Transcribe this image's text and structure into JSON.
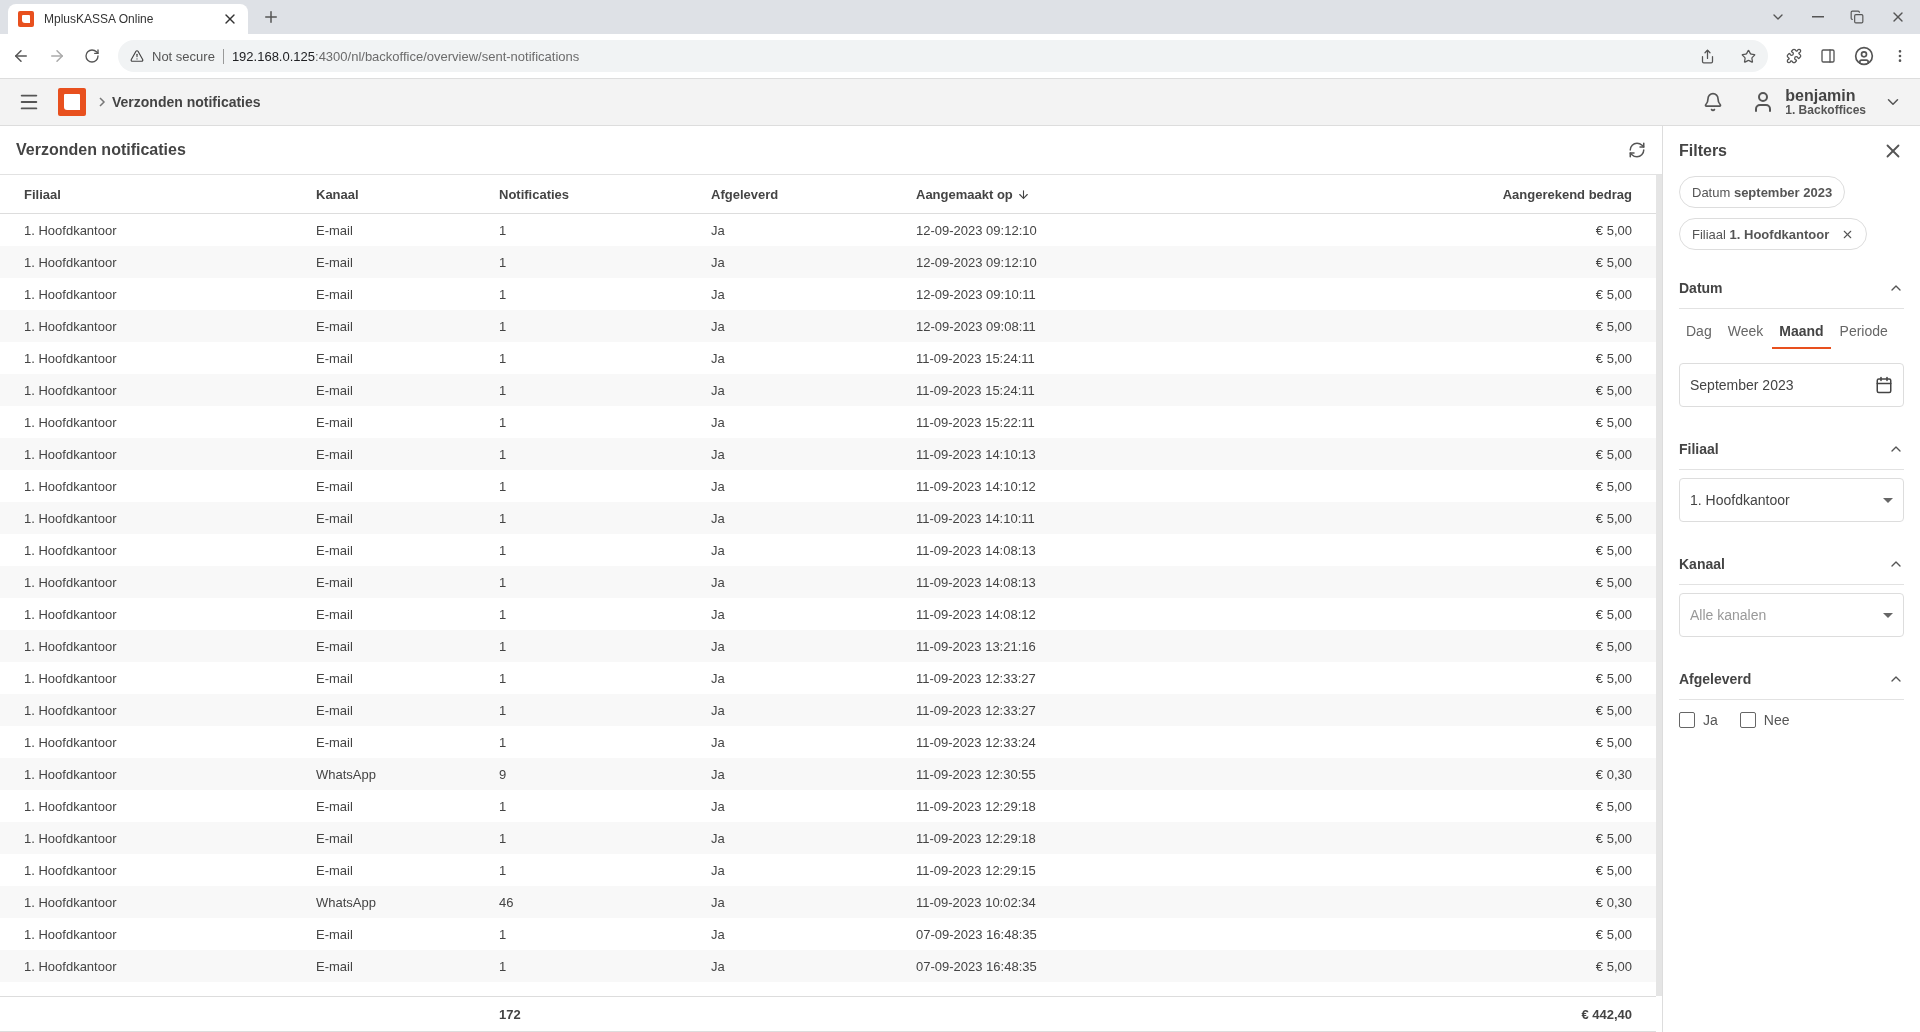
{
  "browser": {
    "tab_title": "MplusKASSA Online",
    "security": "Not secure",
    "url_host": "192.168.0.125",
    "url_path": ":4300/nl/backoffice/overview/sent-notifications"
  },
  "header": {
    "breadcrumb": "Verzonden notificaties",
    "user_name": "benjamin",
    "user_sub": "1. Backoffices"
  },
  "page": {
    "title": "Verzonden notificaties"
  },
  "table": {
    "columns": [
      {
        "label": "Filiaal",
        "sorted": false
      },
      {
        "label": "Kanaal",
        "sorted": false
      },
      {
        "label": "Notificaties",
        "sorted": false
      },
      {
        "label": "Afgeleverd",
        "sorted": false
      },
      {
        "label": "Aangemaakt op",
        "sorted": true
      },
      {
        "label": "Aangerekend bedrag",
        "sorted": false
      }
    ],
    "rows": [
      [
        "1. Hoofdkantoor",
        "E-mail",
        "1",
        "Ja",
        "12-09-2023 09:12:10",
        "€ 5,00"
      ],
      [
        "1. Hoofdkantoor",
        "E-mail",
        "1",
        "Ja",
        "12-09-2023 09:12:10",
        "€ 5,00"
      ],
      [
        "1. Hoofdkantoor",
        "E-mail",
        "1",
        "Ja",
        "12-09-2023 09:10:11",
        "€ 5,00"
      ],
      [
        "1. Hoofdkantoor",
        "E-mail",
        "1",
        "Ja",
        "12-09-2023 09:08:11",
        "€ 5,00"
      ],
      [
        "1. Hoofdkantoor",
        "E-mail",
        "1",
        "Ja",
        "11-09-2023 15:24:11",
        "€ 5,00"
      ],
      [
        "1. Hoofdkantoor",
        "E-mail",
        "1",
        "Ja",
        "11-09-2023 15:24:11",
        "€ 5,00"
      ],
      [
        "1. Hoofdkantoor",
        "E-mail",
        "1",
        "Ja",
        "11-09-2023 15:22:11",
        "€ 5,00"
      ],
      [
        "1. Hoofdkantoor",
        "E-mail",
        "1",
        "Ja",
        "11-09-2023 14:10:13",
        "€ 5,00"
      ],
      [
        "1. Hoofdkantoor",
        "E-mail",
        "1",
        "Ja",
        "11-09-2023 14:10:12",
        "€ 5,00"
      ],
      [
        "1. Hoofdkantoor",
        "E-mail",
        "1",
        "Ja",
        "11-09-2023 14:10:11",
        "€ 5,00"
      ],
      [
        "1. Hoofdkantoor",
        "E-mail",
        "1",
        "Ja",
        "11-09-2023 14:08:13",
        "€ 5,00"
      ],
      [
        "1. Hoofdkantoor",
        "E-mail",
        "1",
        "Ja",
        "11-09-2023 14:08:13",
        "€ 5,00"
      ],
      [
        "1. Hoofdkantoor",
        "E-mail",
        "1",
        "Ja",
        "11-09-2023 14:08:12",
        "€ 5,00"
      ],
      [
        "1. Hoofdkantoor",
        "E-mail",
        "1",
        "Ja",
        "11-09-2023 13:21:16",
        "€ 5,00"
      ],
      [
        "1. Hoofdkantoor",
        "E-mail",
        "1",
        "Ja",
        "11-09-2023 12:33:27",
        "€ 5,00"
      ],
      [
        "1. Hoofdkantoor",
        "E-mail",
        "1",
        "Ja",
        "11-09-2023 12:33:27",
        "€ 5,00"
      ],
      [
        "1. Hoofdkantoor",
        "E-mail",
        "1",
        "Ja",
        "11-09-2023 12:33:24",
        "€ 5,00"
      ],
      [
        "1. Hoofdkantoor",
        "WhatsApp",
        "9",
        "Ja",
        "11-09-2023 12:30:55",
        "€ 0,30"
      ],
      [
        "1. Hoofdkantoor",
        "E-mail",
        "1",
        "Ja",
        "11-09-2023 12:29:18",
        "€ 5,00"
      ],
      [
        "1. Hoofdkantoor",
        "E-mail",
        "1",
        "Ja",
        "11-09-2023 12:29:18",
        "€ 5,00"
      ],
      [
        "1. Hoofdkantoor",
        "E-mail",
        "1",
        "Ja",
        "11-09-2023 12:29:15",
        "€ 5,00"
      ],
      [
        "1. Hoofdkantoor",
        "WhatsApp",
        "46",
        "Ja",
        "11-09-2023 10:02:34",
        "€ 0,30"
      ],
      [
        "1. Hoofdkantoor",
        "E-mail",
        "1",
        "Ja",
        "07-09-2023 16:48:35",
        "€ 5,00"
      ],
      [
        "1. Hoofdkantoor",
        "E-mail",
        "1",
        "Ja",
        "07-09-2023 16:48:35",
        "€ 5,00"
      ]
    ],
    "totals": {
      "notificaties": "172",
      "bedrag": "€ 442,40"
    }
  },
  "filters": {
    "title": "Filters",
    "chips": [
      {
        "text": "Datum **september 2023**",
        "removable": false
      },
      {
        "text": "Filiaal **1. Hoofdkantoor**",
        "removable": true
      }
    ],
    "sections": [
      {
        "kind": "date",
        "title": "Datum",
        "expanded": true,
        "tabs": [
          {
            "label": "Dag",
            "selected": false
          },
          {
            "label": "Week",
            "selected": false
          },
          {
            "label": "Maand",
            "selected": true
          },
          {
            "label": "Periode",
            "selected": false
          }
        ],
        "value": "September 2023"
      },
      {
        "kind": "select",
        "title": "Filiaal",
        "expanded": true,
        "value": "1. Hoofdkantoor"
      },
      {
        "kind": "select",
        "title": "Kanaal",
        "expanded": true,
        "placeholder": "Alle kanalen"
      },
      {
        "kind": "checks",
        "title": "Afgeleverd",
        "expanded": true,
        "options": [
          {
            "label": "Ja",
            "checked": false
          },
          {
            "label": "Nee",
            "checked": false
          }
        ]
      }
    ]
  }
}
